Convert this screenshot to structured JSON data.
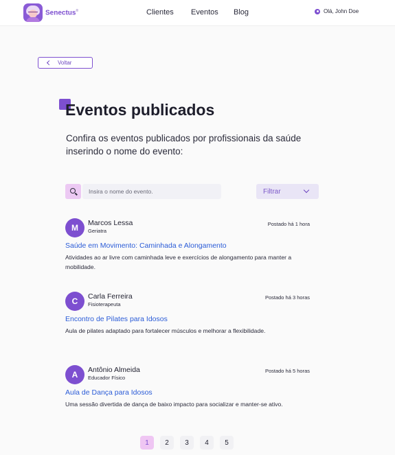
{
  "header": {
    "brand": "Senectus",
    "brand_mark": "®",
    "nav": [
      "Clientes",
      "Eventos",
      "Blog"
    ],
    "greeting": "Olá, John Doe",
    "greeting_icon": "gear-icon"
  },
  "back": {
    "label": "Voltar",
    "icon": "chevron-left-icon"
  },
  "page": {
    "title": "Eventos publicados",
    "description": "Confira os eventos publicados por profissionais da saúde inserindo o nome do evento:"
  },
  "search": {
    "placeholder": "Insira o nome do evento.",
    "value": "",
    "icon": "search-icon"
  },
  "filter": {
    "label": "Filtrar",
    "icon": "chevron-down-icon"
  },
  "events": [
    {
      "initial": "M",
      "author": "Marcos Lessa",
      "role": "Geriatra",
      "posted": "Postado há 1 hora",
      "title": "Saúde em Movimento: Caminhada e Alongamento",
      "description": "Atividades ao ar livre com caminhada leve e exercícios de alongamento para manter a mobilidade."
    },
    {
      "initial": "C",
      "author": "Carla Ferreira",
      "role": "Fisioterapeuta",
      "posted": "Postado há 3 horas",
      "title": "Encontro de Pilates para Idosos",
      "description": "Aula de pilates adaptado para fortalecer músculos e melhorar a flexibilidade."
    },
    {
      "initial": "A",
      "author": "Antônio Almeida",
      "role": "Educador Físico",
      "posted": "Postado há 5 horas",
      "title": "Aula de Dança para Idosos",
      "description": "Uma sessão divertida de dança de baixo impacto para socializar e manter-se ativo."
    }
  ],
  "pagination": {
    "pages": [
      "1",
      "2",
      "3",
      "4",
      "5"
    ],
    "current": "1"
  },
  "colors": {
    "accent": "#7d4fd0",
    "link": "#2a5bd7",
    "active_page": "#efc6f3"
  }
}
